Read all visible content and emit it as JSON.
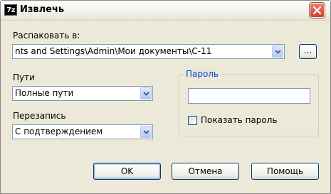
{
  "window": {
    "title": "Извлечь",
    "app_icon": "7z",
    "close_icon": "close-icon"
  },
  "extract_to": {
    "label": "Распаковать в:",
    "path": "nts and Settings\\Admin\\Мои документы\\C-11",
    "browse_label": "..."
  },
  "paths": {
    "label": "Пути",
    "value": "Полные пути"
  },
  "overwrite": {
    "label": "Перезапись",
    "value": "С подтверждением"
  },
  "password": {
    "group_title": "Пароль",
    "value": "",
    "show_label": "Показать пароль",
    "show_checked": false
  },
  "buttons": {
    "ok": "OK",
    "cancel": "Отмена",
    "help": "Помощь"
  },
  "colors": {
    "group_title": "#0046d5",
    "close": "#c8452a",
    "dialog_bg": "#ece9d8"
  }
}
